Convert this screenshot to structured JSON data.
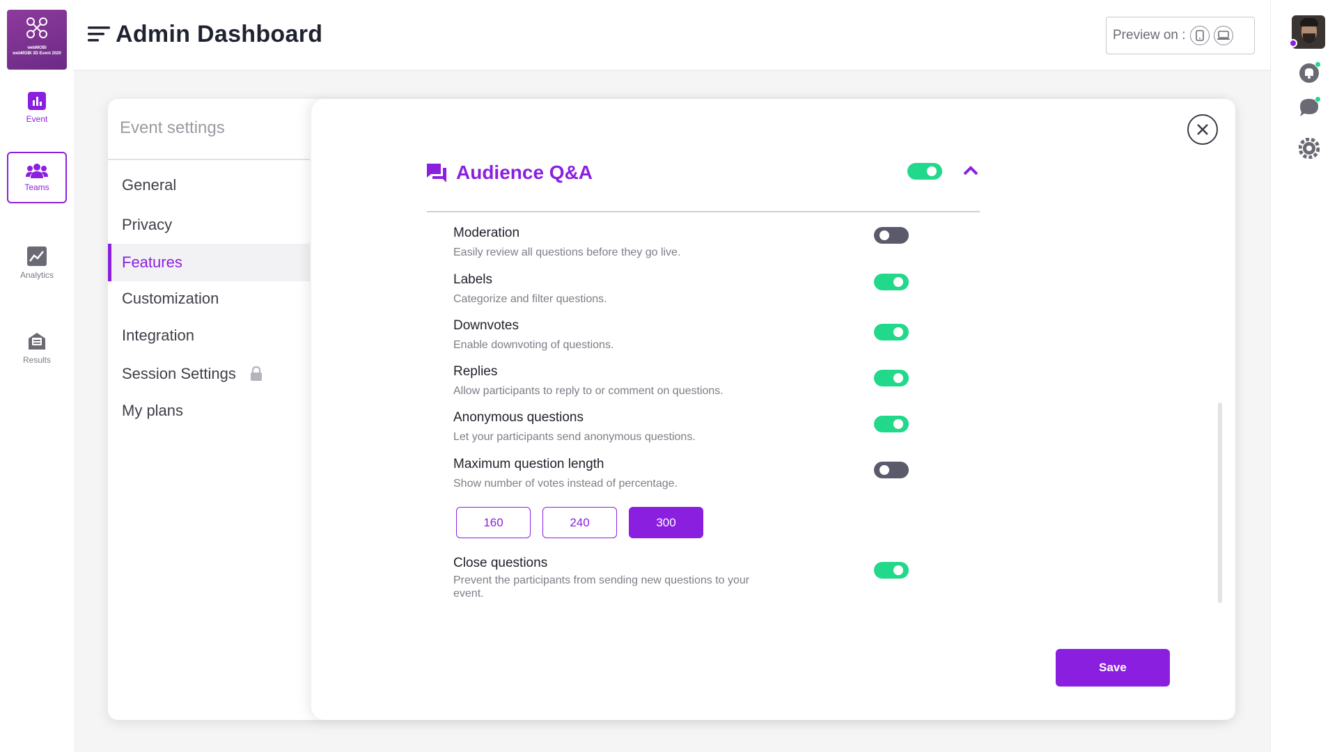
{
  "brand": {
    "logo_line1": "webMOBI",
    "logo_line2": "webMOBI 3D Event 2020",
    "accent": "#8a1fe0",
    "on_color": "#22d88a",
    "off_color": "#5b5a6a"
  },
  "left_nav": {
    "items": [
      {
        "label": "Event",
        "icon": "bar-chart-icon"
      },
      {
        "label": "Teams",
        "icon": "team-icon"
      },
      {
        "label": "Analytics",
        "icon": "analytics-icon"
      },
      {
        "label": "Results",
        "icon": "results-icon"
      }
    ]
  },
  "header": {
    "title": "Admin Dashboard",
    "preview_label": "Preview on :"
  },
  "settings_menu": {
    "title": "Event settings",
    "items": [
      {
        "label": "General"
      },
      {
        "label": "Privacy"
      },
      {
        "label": "Features",
        "active": true
      },
      {
        "label": "Customization"
      },
      {
        "label": "Integration"
      },
      {
        "label": "Session Settings",
        "locked": true
      },
      {
        "label": "My plans"
      }
    ]
  },
  "section": {
    "title": "Audience Q&A",
    "enabled": true,
    "expanded": true,
    "features": [
      {
        "name": "Moderation",
        "desc": "Easily review all questions before they go live.",
        "enabled": false
      },
      {
        "name": "Labels",
        "desc": "Categorize and filter questions.",
        "enabled": true
      },
      {
        "name": "Downvotes",
        "desc": "Enable downvoting of questions.",
        "enabled": true
      },
      {
        "name": "Replies",
        "desc": "Allow participants to reply to or comment on questions.",
        "enabled": true
      },
      {
        "name": "Anonymous questions",
        "desc": "Let your participants send anonymous questions.",
        "enabled": true
      },
      {
        "name": "Maximum question length",
        "desc": "Show number of votes instead of percentage.",
        "enabled": false
      },
      {
        "name": "Close questions",
        "desc": "Prevent the participants from sending new questions to your event.",
        "enabled": true
      }
    ],
    "length_options": [
      "160",
      "240",
      "300"
    ],
    "length_selected": "300"
  },
  "actions": {
    "save_label": "Save"
  }
}
